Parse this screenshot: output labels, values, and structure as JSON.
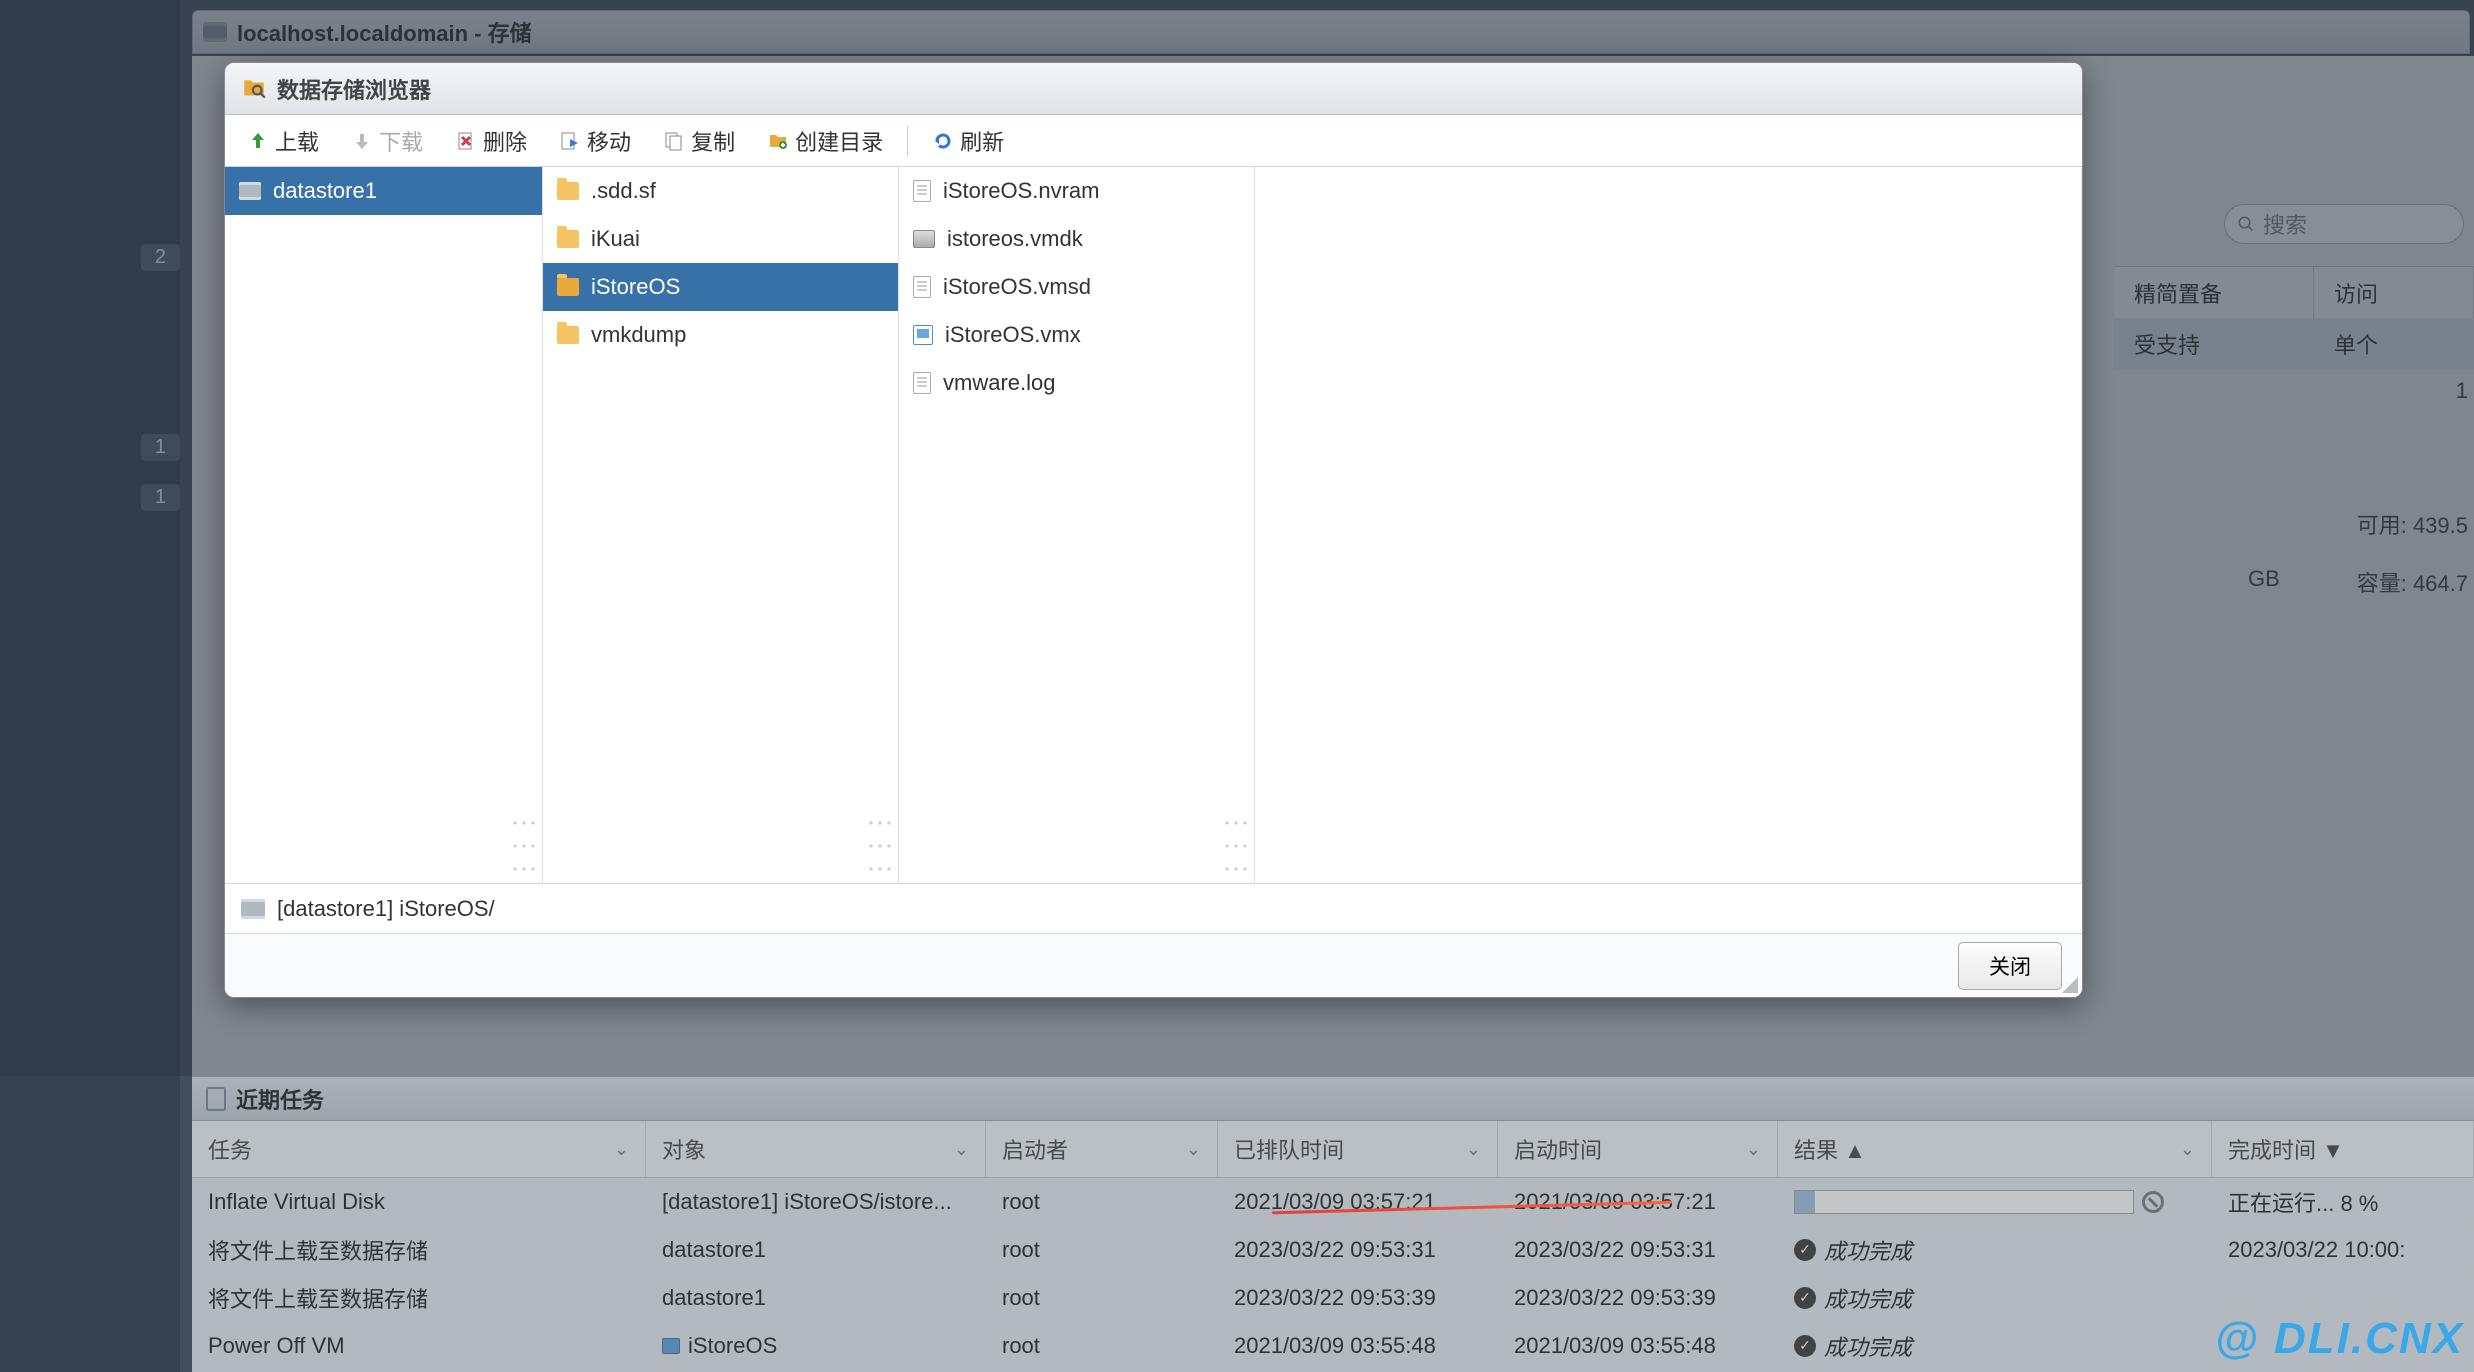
{
  "main_header": {
    "title": "localhost.localdomain - 存储"
  },
  "sidebar_badges": [
    "2",
    "1",
    "1"
  ],
  "bg": {
    "search_placeholder": "搜索",
    "head": {
      "thin": "精简置备",
      "access": "访问"
    },
    "row": {
      "thin": "受支持",
      "access": "单个"
    },
    "count": "1",
    "avail": "可用: 439.5",
    "gb": "GB",
    "cap": "容量: 464.7"
  },
  "dialog": {
    "title": "数据存储浏览器",
    "toolbar": {
      "upload": "上载",
      "download": "下载",
      "delete": "删除",
      "move": "移动",
      "copy": "复制",
      "mkdir": "创建目录",
      "refresh": "刷新"
    },
    "col1": [
      {
        "label": "datastore1",
        "icon": "datastore",
        "selected": true
      }
    ],
    "col2": [
      {
        "label": ".sdd.sf",
        "icon": "folder"
      },
      {
        "label": "iKuai",
        "icon": "folder"
      },
      {
        "label": "iStoreOS",
        "icon": "folder-open",
        "selected": true
      },
      {
        "label": "vmkdump",
        "icon": "folder"
      }
    ],
    "col3": [
      {
        "label": "iStoreOS.nvram",
        "icon": "file"
      },
      {
        "label": "istoreos.vmdk",
        "icon": "disk"
      },
      {
        "label": "iStoreOS.vmsd",
        "icon": "file"
      },
      {
        "label": "iStoreOS.vmx",
        "icon": "vmx"
      },
      {
        "label": "vmware.log",
        "icon": "file"
      }
    ],
    "path": "[datastore1] iStoreOS/",
    "close": "关闭"
  },
  "tasks": {
    "title": "近期任务",
    "columns": {
      "task": "任务",
      "target": "对象",
      "initiator": "启动者",
      "queued": "已排队时间",
      "started": "启动时间",
      "result": "结果 ▲",
      "completed": "完成时间 ▼"
    },
    "rows": [
      {
        "task": "Inflate Virtual Disk",
        "target": "[datastore1] iStoreOS/istore...",
        "initiator": "root",
        "queued": "2021/03/09 03:57:21",
        "started": "2021/03/09 03:57:21",
        "result_type": "progress",
        "progress": 6,
        "completed": "正在运行... 8 %"
      },
      {
        "task": "将文件上载至数据存储",
        "target": "datastore1",
        "initiator": "root",
        "queued": "2023/03/22 09:53:31",
        "started": "2023/03/22 09:53:31",
        "result_type": "success",
        "result": "成功完成",
        "completed": "2023/03/22 10:00:"
      },
      {
        "task": "将文件上载至数据存储",
        "target": "datastore1",
        "initiator": "root",
        "queued": "2023/03/22 09:53:39",
        "started": "2023/03/22 09:53:39",
        "result_type": "success",
        "result": "成功完成",
        "completed": ""
      },
      {
        "task": "Power Off VM",
        "target": "iStoreOS",
        "target_icon": "vm",
        "initiator": "root",
        "queued": "2021/03/09 03:55:48",
        "started": "2021/03/09 03:55:48",
        "result_type": "success",
        "result": "成功完成",
        "completed": ""
      }
    ]
  },
  "watermark": "@  DLI.CNX"
}
